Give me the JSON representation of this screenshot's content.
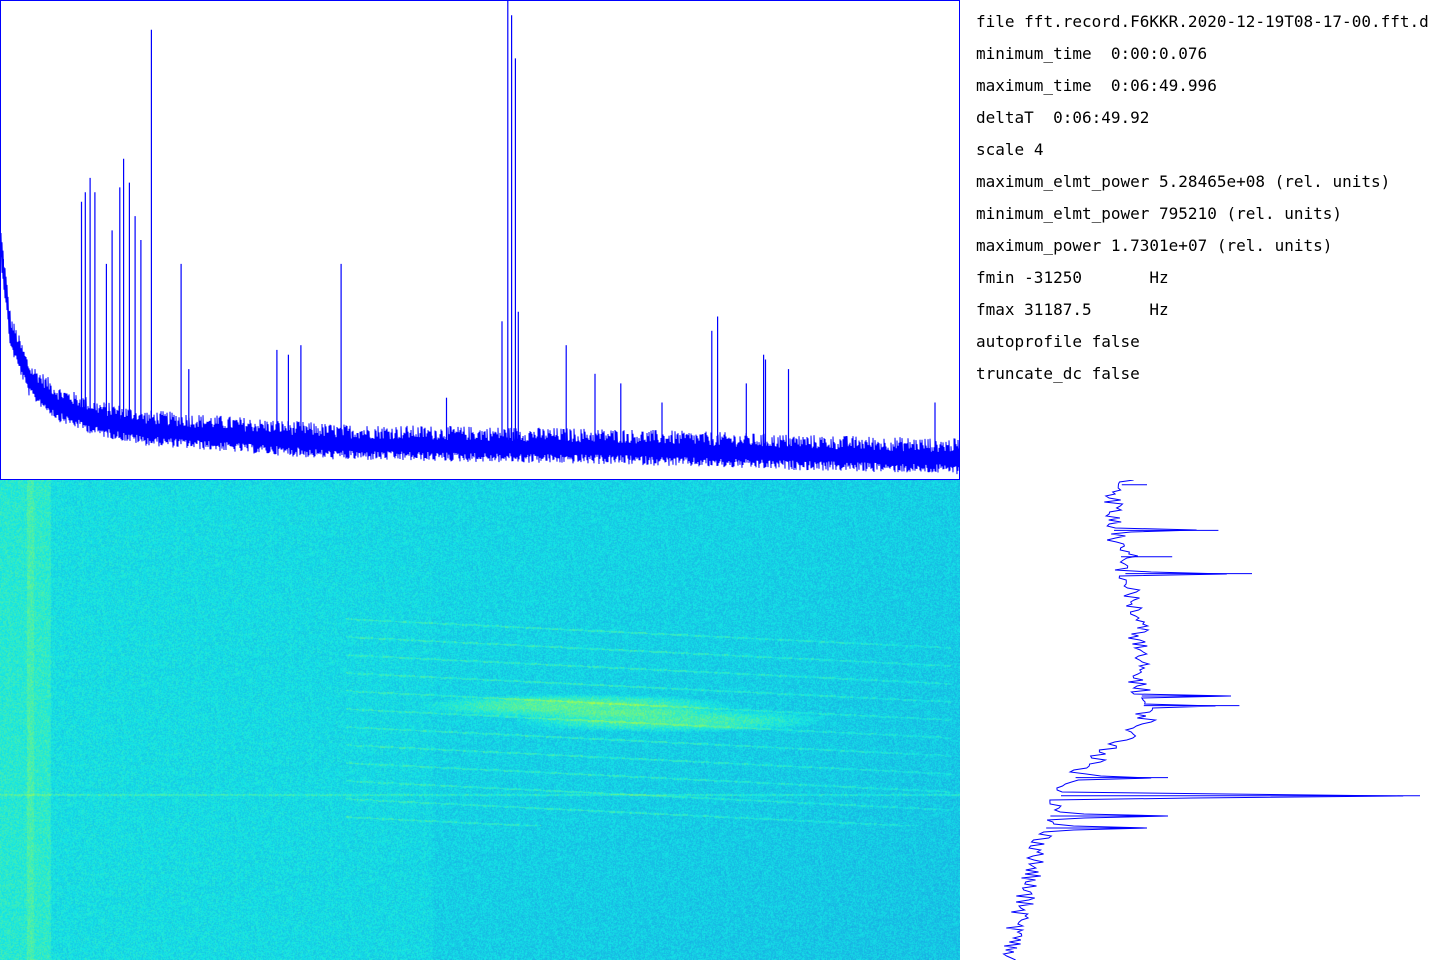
{
  "info": {
    "file_label": "file",
    "file_value": "fft.record.F6KKR.2020-12-19T08-17-00.fft.d",
    "minimum_time_label": "minimum_time",
    "minimum_time_value": "0:00:0.076",
    "maximum_time_label": "maximum_time",
    "maximum_time_value": "0:06:49.996",
    "deltaT_label": "deltaT",
    "deltaT_value": "0:06:49.92",
    "scale_label": "scale",
    "scale_value": "4",
    "maximum_elmt_power_label": "maximum_elmt_power",
    "maximum_elmt_power_value": "5.28465e+08",
    "maximum_elmt_power_unit": "(rel. units)",
    "minimum_elmt_power_label": "minimum_elmt_power",
    "minimum_elmt_power_value": "795210",
    "minimum_elmt_power_unit": "(rel. units)",
    "maximum_power_label": "maximum_power",
    "maximum_power_value": "1.7301e+07",
    "maximum_power_unit": "(rel. units)",
    "fmin_label": "fmin",
    "fmin_value": "-31250",
    "fmin_unit": "Hz",
    "fmax_label": "fmax",
    "fmax_value": "31187.5",
    "fmax_unit": "Hz",
    "autoprofile_label": "autoprofile",
    "autoprofile_value": "false",
    "truncate_dc_label": "truncate_dc",
    "truncate_dc_value": "false"
  },
  "colors": {
    "trace": "#0000ff",
    "border": "#0000ff",
    "background": "#ffffff",
    "waterfall_low": "#1e6ee0",
    "waterfall_mid": "#14e6e6",
    "waterfall_high": "#b4ff3c",
    "info_text": "#000000"
  },
  "chart_data": [
    {
      "type": "line",
      "name_hint": "spectrum",
      "x_range": [
        -31250,
        31187.5
      ],
      "axis_scale": "linear power (rel. units)",
      "baseline_profile": {
        "x_fraction": [
          0.0,
          0.01,
          0.03,
          0.06,
          0.1,
          0.15,
          0.25,
          0.35,
          0.5,
          0.65,
          0.8,
          0.9,
          1.0
        ],
        "relative_power": [
          0.48,
          0.3,
          0.2,
          0.15,
          0.12,
          0.1,
          0.085,
          0.07,
          0.065,
          0.06,
          0.05,
          0.045,
          0.04
        ]
      },
      "peaks": [
        {
          "x_fraction": 0.0025,
          "relative_power": 0.46
        },
        {
          "x_fraction": 0.084,
          "relative_power": 0.58
        },
        {
          "x_fraction": 0.088,
          "relative_power": 0.6
        },
        {
          "x_fraction": 0.093,
          "relative_power": 0.63
        },
        {
          "x_fraction": 0.098,
          "relative_power": 0.6
        },
        {
          "x_fraction": 0.11,
          "relative_power": 0.45
        },
        {
          "x_fraction": 0.116,
          "relative_power": 0.52
        },
        {
          "x_fraction": 0.124,
          "relative_power": 0.61
        },
        {
          "x_fraction": 0.128,
          "relative_power": 0.67
        },
        {
          "x_fraction": 0.134,
          "relative_power": 0.62
        },
        {
          "x_fraction": 0.14,
          "relative_power": 0.55
        },
        {
          "x_fraction": 0.146,
          "relative_power": 0.5
        },
        {
          "x_fraction": 0.157,
          "relative_power": 0.94
        },
        {
          "x_fraction": 0.188,
          "relative_power": 0.45
        },
        {
          "x_fraction": 0.196,
          "relative_power": 0.23
        },
        {
          "x_fraction": 0.288,
          "relative_power": 0.27
        },
        {
          "x_fraction": 0.3,
          "relative_power": 0.26
        },
        {
          "x_fraction": 0.313,
          "relative_power": 0.28
        },
        {
          "x_fraction": 0.355,
          "relative_power": 0.45
        },
        {
          "x_fraction": 0.465,
          "relative_power": 0.17
        },
        {
          "x_fraction": 0.523,
          "relative_power": 0.33
        },
        {
          "x_fraction": 0.529,
          "relative_power": 1.0
        },
        {
          "x_fraction": 0.533,
          "relative_power": 0.97
        },
        {
          "x_fraction": 0.537,
          "relative_power": 0.88
        },
        {
          "x_fraction": 0.54,
          "relative_power": 0.35
        },
        {
          "x_fraction": 0.59,
          "relative_power": 0.28
        },
        {
          "x_fraction": 0.62,
          "relative_power": 0.22
        },
        {
          "x_fraction": 0.647,
          "relative_power": 0.2
        },
        {
          "x_fraction": 0.69,
          "relative_power": 0.16
        },
        {
          "x_fraction": 0.742,
          "relative_power": 0.31
        },
        {
          "x_fraction": 0.748,
          "relative_power": 0.34
        },
        {
          "x_fraction": 0.778,
          "relative_power": 0.2
        },
        {
          "x_fraction": 0.796,
          "relative_power": 0.26
        },
        {
          "x_fraction": 0.798,
          "relative_power": 0.25
        },
        {
          "x_fraction": 0.822,
          "relative_power": 0.23
        },
        {
          "x_fraction": 0.975,
          "relative_power": 0.16
        }
      ]
    },
    {
      "type": "heatmap",
      "name_hint": "waterfall",
      "x_range": [
        -31250,
        31187.5
      ],
      "time_range": [
        "0:00:0.076",
        "0:06:49.996"
      ],
      "colormap": "blue-cyan-yellowgreen",
      "features": [
        {
          "kind": "vertical_band",
          "x_fraction": 0.04,
          "width_fraction": 0.025,
          "strength": 0.35
        },
        {
          "kind": "horizontal_line",
          "t_fraction": 0.655,
          "strength": 0.35
        },
        {
          "kind": "chirp_group",
          "x_start_fraction": 0.36,
          "x_end_fraction": 0.99,
          "t_start_fraction": 0.27,
          "t_end_fraction": 0.72,
          "count": 12,
          "strength": 0.5
        },
        {
          "kind": "bright_spot",
          "x_fraction": 0.6,
          "t_fraction": 0.47,
          "strength": 0.9
        },
        {
          "kind": "bright_spot",
          "x_fraction": 0.7,
          "t_fraction": 0.5,
          "strength": 0.8
        }
      ]
    },
    {
      "type": "line",
      "name_hint": "time_profile",
      "orientation": "vertical",
      "t_range": [
        "0:00:0.076",
        "0:06:49.996"
      ],
      "profile": {
        "t_fraction": [
          0.0,
          0.02,
          0.05,
          0.1,
          0.2,
          0.3,
          0.42,
          0.5,
          0.55,
          0.6,
          0.65,
          0.7,
          0.8,
          0.9,
          1.0
        ],
        "relative_power": [
          0.3,
          0.28,
          0.27,
          0.27,
          0.3,
          0.33,
          0.33,
          0.35,
          0.28,
          0.2,
          0.15,
          0.12,
          0.08,
          0.05,
          0.02
        ]
      },
      "peaks": [
        {
          "t_fraction": 0.01,
          "relative_power": 0.35
        },
        {
          "t_fraction": 0.105,
          "relative_power": 0.52
        },
        {
          "t_fraction": 0.16,
          "relative_power": 0.41
        },
        {
          "t_fraction": 0.195,
          "relative_power": 0.6
        },
        {
          "t_fraction": 0.45,
          "relative_power": 0.55
        },
        {
          "t_fraction": 0.47,
          "relative_power": 0.57
        },
        {
          "t_fraction": 0.62,
          "relative_power": 0.4
        },
        {
          "t_fraction": 0.658,
          "relative_power": 1.0
        },
        {
          "t_fraction": 0.7,
          "relative_power": 0.4
        },
        {
          "t_fraction": 0.725,
          "relative_power": 0.35
        }
      ]
    }
  ]
}
